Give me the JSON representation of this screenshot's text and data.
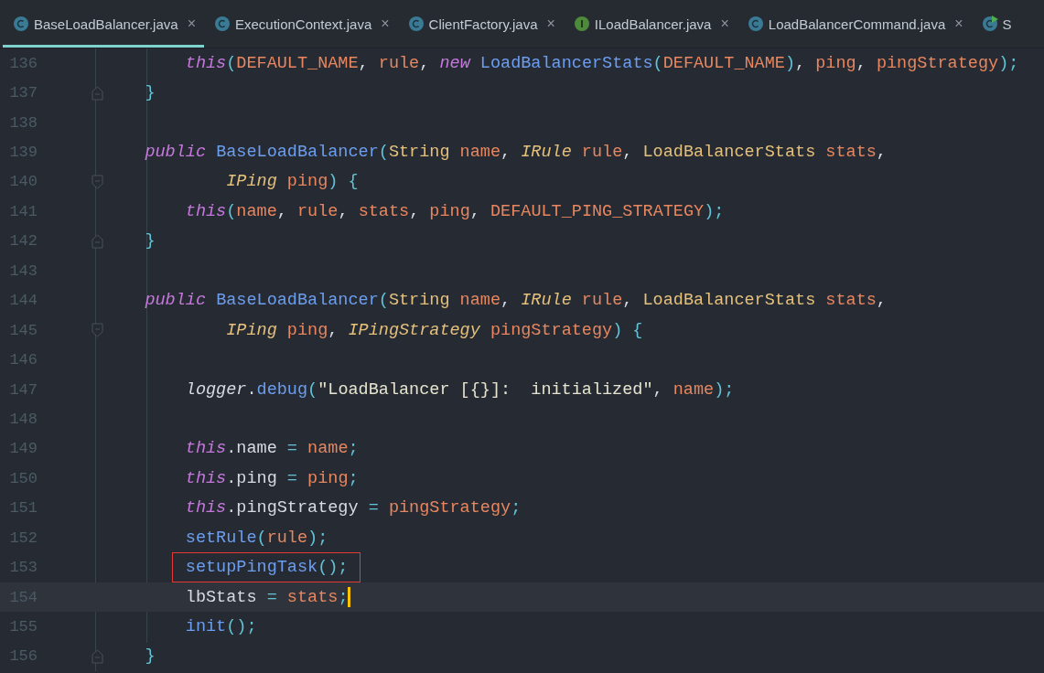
{
  "tabs": [
    {
      "label": "BaseLoadBalancer.java",
      "kind": "class",
      "selected": true,
      "closable": true
    },
    {
      "label": "ExecutionContext.java",
      "kind": "class",
      "selected": false,
      "closable": true
    },
    {
      "label": "ClientFactory.java",
      "kind": "class",
      "selected": false,
      "closable": true
    },
    {
      "label": "ILoadBalancer.java",
      "kind": "interface",
      "selected": false,
      "closable": true
    },
    {
      "label": "LoadBalancerCommand.java",
      "kind": "class",
      "selected": false,
      "closable": true
    },
    {
      "label": "S",
      "kind": "runnable",
      "selected": false,
      "closable": false
    }
  ],
  "tab_close_glyph": "×",
  "editor": {
    "lines": [
      {
        "number": "136",
        "kind": "plain",
        "current": false,
        "boxed": false,
        "tokens": [
          {
            "t": "        this",
            "kind": "kw"
          },
          {
            "t": "(",
            "kind": "punct"
          },
          {
            "t": "DEFAULT_NAME",
            "kind": "var"
          },
          {
            "t": ", ",
            "kind": "plain"
          },
          {
            "t": "rule",
            "kind": "var"
          },
          {
            "t": ", ",
            "kind": "plain"
          },
          {
            "t": "new ",
            "kind": "kw"
          },
          {
            "t": "LoadBalancerStats",
            "kind": "fn"
          },
          {
            "t": "(",
            "kind": "punct"
          },
          {
            "t": "DEFAULT_NAME",
            "kind": "var"
          },
          {
            "t": ")",
            "kind": "punct"
          },
          {
            "t": ", ",
            "kind": "plain"
          },
          {
            "t": "ping",
            "kind": "var"
          },
          {
            "t": ", ",
            "kind": "plain"
          },
          {
            "t": "pingStrategy",
            "kind": "var"
          },
          {
            "t": ");",
            "kind": "punct"
          }
        ]
      },
      {
        "number": "137",
        "kind": "fold-end",
        "current": false,
        "boxed": false,
        "tokens": [
          {
            "t": "    }",
            "kind": "punct"
          }
        ]
      },
      {
        "number": "138",
        "kind": "plain",
        "current": false,
        "boxed": false
      },
      {
        "number": "139",
        "kind": "plain",
        "current": false,
        "boxed": false,
        "tokens": [
          {
            "t": "    public ",
            "kind": "kw"
          },
          {
            "t": "BaseLoadBalancer",
            "kind": "fn"
          },
          {
            "t": "(",
            "kind": "punct"
          },
          {
            "t": "String ",
            "kind": "type"
          },
          {
            "t": "name",
            "kind": "var"
          },
          {
            "t": ", ",
            "kind": "plain"
          },
          {
            "t": "IRule ",
            "kind": "iface"
          },
          {
            "t": "rule",
            "kind": "var"
          },
          {
            "t": ", ",
            "kind": "plain"
          },
          {
            "t": "LoadBalancerStats ",
            "kind": "type"
          },
          {
            "t": "stats",
            "kind": "var"
          },
          {
            "t": ",",
            "kind": "plain"
          }
        ]
      },
      {
        "number": "140",
        "kind": "fold-start",
        "current": false,
        "boxed": false,
        "tokens": [
          {
            "t": "            IPing ",
            "kind": "iface"
          },
          {
            "t": "ping",
            "kind": "var"
          },
          {
            "t": ") {",
            "kind": "punct"
          }
        ]
      },
      {
        "number": "141",
        "kind": "plain",
        "current": false,
        "boxed": false,
        "tokens": [
          {
            "t": "        this",
            "kind": "kw"
          },
          {
            "t": "(",
            "kind": "punct"
          },
          {
            "t": "name",
            "kind": "var"
          },
          {
            "t": ", ",
            "kind": "plain"
          },
          {
            "t": "rule",
            "kind": "var"
          },
          {
            "t": ", ",
            "kind": "plain"
          },
          {
            "t": "stats",
            "kind": "var"
          },
          {
            "t": ", ",
            "kind": "plain"
          },
          {
            "t": "ping",
            "kind": "var"
          },
          {
            "t": ", ",
            "kind": "plain"
          },
          {
            "t": "DEFAULT_PING_STRATEGY",
            "kind": "var"
          },
          {
            "t": ");",
            "kind": "punct"
          }
        ]
      },
      {
        "number": "142",
        "kind": "fold-end",
        "current": false,
        "boxed": false,
        "tokens": [
          {
            "t": "    }",
            "kind": "punct"
          }
        ]
      },
      {
        "number": "143",
        "kind": "plain",
        "current": false,
        "boxed": false
      },
      {
        "number": "144",
        "kind": "plain",
        "current": false,
        "boxed": false,
        "tokens": [
          {
            "t": "    public ",
            "kind": "kw"
          },
          {
            "t": "BaseLoadBalancer",
            "kind": "fn"
          },
          {
            "t": "(",
            "kind": "punct"
          },
          {
            "t": "String ",
            "kind": "type"
          },
          {
            "t": "name",
            "kind": "var"
          },
          {
            "t": ", ",
            "kind": "plain"
          },
          {
            "t": "IRule ",
            "kind": "iface"
          },
          {
            "t": "rule",
            "kind": "var"
          },
          {
            "t": ", ",
            "kind": "plain"
          },
          {
            "t": "LoadBalancerStats ",
            "kind": "type"
          },
          {
            "t": "stats",
            "kind": "var"
          },
          {
            "t": ",",
            "kind": "plain"
          }
        ]
      },
      {
        "number": "145",
        "kind": "fold-start",
        "current": false,
        "boxed": false,
        "tokens": [
          {
            "t": "            IPing ",
            "kind": "iface"
          },
          {
            "t": "ping",
            "kind": "var"
          },
          {
            "t": ", ",
            "kind": "plain"
          },
          {
            "t": "IPingStrategy ",
            "kind": "iface"
          },
          {
            "t": "pingStrategy",
            "kind": "var"
          },
          {
            "t": ") {",
            "kind": "punct"
          }
        ]
      },
      {
        "number": "146",
        "kind": "plain",
        "current": false,
        "boxed": false
      },
      {
        "number": "147",
        "kind": "plain",
        "current": false,
        "boxed": false,
        "tokens": [
          {
            "t": "        logger",
            "kind": "italic"
          },
          {
            "t": ".",
            "kind": "plain"
          },
          {
            "t": "debug",
            "kind": "fn"
          },
          {
            "t": "(",
            "kind": "punct"
          },
          {
            "t": "\"LoadBalancer [{}]:  initialized\"",
            "kind": "str"
          },
          {
            "t": ", ",
            "kind": "plain"
          },
          {
            "t": "name",
            "kind": "var"
          },
          {
            "t": ");",
            "kind": "punct"
          }
        ]
      },
      {
        "number": "148",
        "kind": "plain",
        "current": false,
        "boxed": false
      },
      {
        "number": "149",
        "kind": "plain",
        "current": false,
        "boxed": false,
        "tokens": [
          {
            "t": "        this",
            "kind": "kw"
          },
          {
            "t": ".name ",
            "kind": "plain"
          },
          {
            "t": "= ",
            "kind": "punct"
          },
          {
            "t": "name",
            "kind": "var"
          },
          {
            "t": ";",
            "kind": "punct"
          }
        ]
      },
      {
        "number": "150",
        "kind": "plain",
        "current": false,
        "boxed": false,
        "tokens": [
          {
            "t": "        this",
            "kind": "kw"
          },
          {
            "t": ".ping ",
            "kind": "plain"
          },
          {
            "t": "= ",
            "kind": "punct"
          },
          {
            "t": "ping",
            "kind": "var"
          },
          {
            "t": ";",
            "kind": "punct"
          }
        ]
      },
      {
        "number": "151",
        "kind": "plain",
        "current": false,
        "boxed": false,
        "tokens": [
          {
            "t": "        this",
            "kind": "kw"
          },
          {
            "t": ".pingStrategy ",
            "kind": "plain"
          },
          {
            "t": "= ",
            "kind": "punct"
          },
          {
            "t": "pingStrategy",
            "kind": "var"
          },
          {
            "t": ";",
            "kind": "punct"
          }
        ]
      },
      {
        "number": "152",
        "kind": "plain",
        "current": false,
        "boxed": false,
        "tokens": [
          {
            "t": "        setRule",
            "kind": "fn"
          },
          {
            "t": "(",
            "kind": "punct"
          },
          {
            "t": "rule",
            "kind": "var"
          },
          {
            "t": ");",
            "kind": "punct"
          }
        ]
      },
      {
        "number": "153",
        "kind": "plain",
        "current": false,
        "boxed": true,
        "tokens": [
          {
            "t": "        setupPingTask",
            "kind": "fn"
          },
          {
            "t": "();",
            "kind": "punct"
          }
        ]
      },
      {
        "number": "154",
        "kind": "plain",
        "current": true,
        "boxed": false,
        "tokens": [
          {
            "t": "        lbStats ",
            "kind": "plain"
          },
          {
            "t": "= ",
            "kind": "punct"
          },
          {
            "t": "stats",
            "kind": "var"
          },
          {
            "t": ";",
            "kind": "punct"
          }
        ]
      },
      {
        "number": "155",
        "kind": "plain",
        "current": false,
        "boxed": false,
        "tokens": [
          {
            "t": "        init",
            "kind": "fn"
          },
          {
            "t": "();",
            "kind": "punct"
          }
        ]
      },
      {
        "number": "156",
        "kind": "fold-end",
        "current": false,
        "boxed": false,
        "tokens": [
          {
            "t": "    }",
            "kind": "punct"
          }
        ]
      }
    ]
  }
}
